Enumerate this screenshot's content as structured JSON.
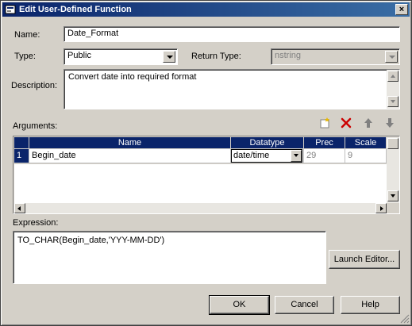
{
  "window": {
    "title": "Edit User-Defined Function",
    "close_glyph": "×"
  },
  "form": {
    "name_label": "Name:",
    "name_value": "Date_Format",
    "type_label": "Type:",
    "type_value": "Public",
    "return_type_label": "Return Type:",
    "return_type_value": "nstring",
    "description_label": "Description:",
    "description_value": "Convert date into required format",
    "arguments_label": "Arguments:",
    "expression_label": "Expression:",
    "expression_value": "TO_CHAR(Begin_date,'YYY-MM-DD')"
  },
  "arguments_toolbar": {
    "icons": [
      "new-row-icon",
      "delete-icon",
      "move-up-icon",
      "move-down-icon"
    ]
  },
  "arguments_table": {
    "columns": [
      "Name",
      "Datatype",
      "Prec",
      "Scale"
    ],
    "rows": [
      {
        "index": "1",
        "name": "Begin_date",
        "datatype": "date/time",
        "prec": "29",
        "scale": "9"
      }
    ]
  },
  "buttons": {
    "launch_editor": "Launch Editor...",
    "ok": "OK",
    "cancel": "Cancel",
    "help": "Help"
  },
  "colors": {
    "title_bar": "#0a246a",
    "header": "#0a246a",
    "face": "#d4d0c8",
    "delete": "#cc0000"
  }
}
